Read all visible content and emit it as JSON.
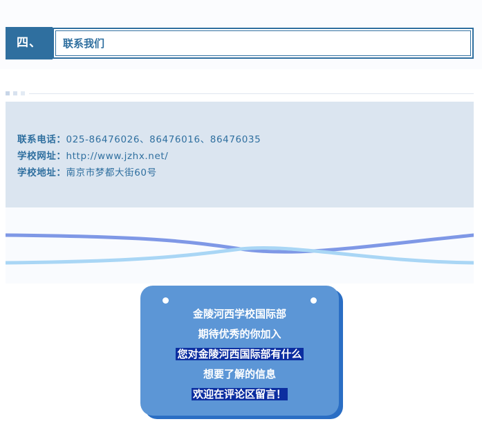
{
  "section": {
    "number": "四、",
    "title": "联系我们"
  },
  "contact": {
    "phone_label": "联系电话：",
    "phone_value": "025-86476026、86476016、86476035",
    "website_label": "学校网址：",
    "website_value": "http://www.jzhx.net/",
    "address_label": "学校地址：",
    "address_value": "南京市梦都大街60号"
  },
  "card": {
    "line1": "金陵河西学校国际部",
    "line2": "期待优秀的你加入",
    "line3": "您对金陵河西国际部有什么",
    "line4": "想要了解的信息",
    "line5": "欢迎在评论区留言！"
  },
  "colors": {
    "accent": "#2f6f9f",
    "contact_bg": "#dbe5f0",
    "card_bg": "#5c96d6",
    "card_shadow": "#2a6ec4",
    "highlight": "#0c2ea0",
    "wave_dark": "#7f98e6",
    "wave_light": "#a9d6f5"
  }
}
